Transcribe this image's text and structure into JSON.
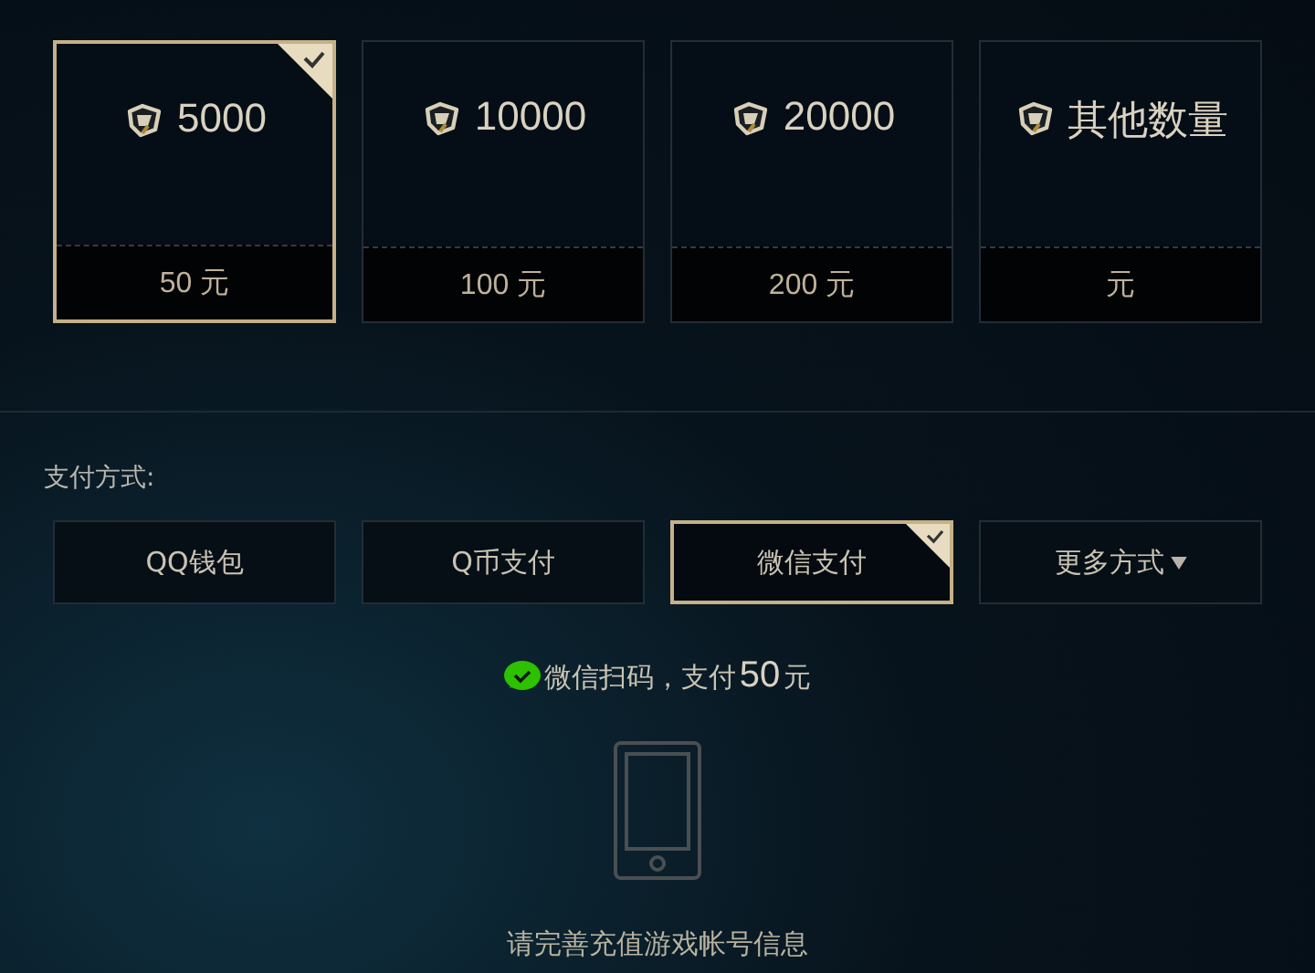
{
  "packages": [
    {
      "amount": "5000",
      "price": "50 元",
      "selected": true
    },
    {
      "amount": "10000",
      "price": "100 元",
      "selected": false
    },
    {
      "amount": "20000",
      "price": "200 元",
      "selected": false
    },
    {
      "amount": "其他数量",
      "price": "元",
      "selected": false
    }
  ],
  "payment": {
    "label": "支付方式:",
    "methods": [
      {
        "label": "QQ钱包",
        "kind": "plain",
        "selected": false
      },
      {
        "label": "Q币支付",
        "kind": "plain",
        "selected": false
      },
      {
        "label": "微信支付",
        "kind": "plain",
        "selected": true
      },
      {
        "label": "更多方式",
        "kind": "dropdown",
        "selected": false
      }
    ]
  },
  "notice": {
    "text": "微信扫码，支付",
    "amount": "50",
    "unit": "元"
  },
  "hint": "请完善充值游戏帐号信息"
}
